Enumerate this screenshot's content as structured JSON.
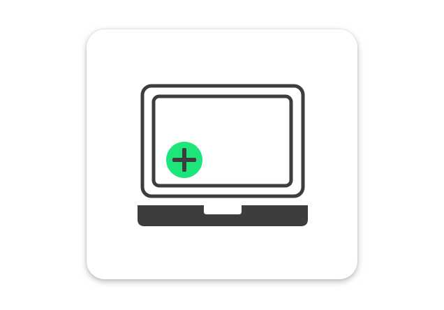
{
  "icon": {
    "name": "laptop-add-icon",
    "colors": {
      "card_background": "#ffffff",
      "stroke": "#3d3d3d",
      "base": "#3d3d3d",
      "badge_fill": "#1de57a",
      "plus": "#3d3d3d"
    }
  }
}
